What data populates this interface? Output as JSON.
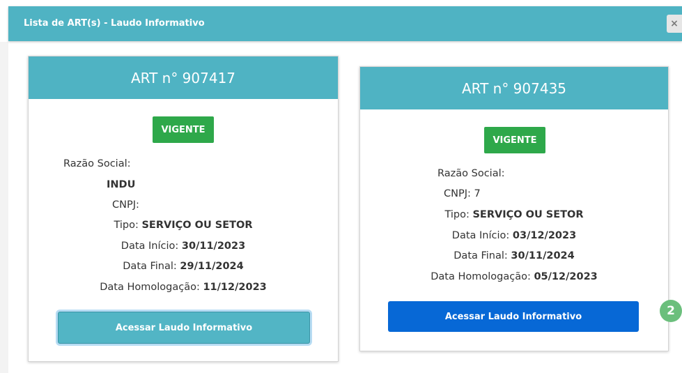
{
  "modal": {
    "title": "Lista de ART(s) - Laudo Informativo",
    "close_label": "×"
  },
  "cards": [
    {
      "header": "ART n° 907417",
      "status": "VIGENTE",
      "razao_social_label": "Razão Social:",
      "razao_social_value": "INDU",
      "cnpj_label": "CNPJ:",
      "cnpj_value": "",
      "tipo_label": "Tipo:",
      "tipo_value": "SERVIÇO OU SETOR",
      "data_inicio_label": "Data Início:",
      "data_inicio_value": "30/11/2023",
      "data_final_label": "Data Final:",
      "data_final_value": "29/11/2024",
      "data_homologacao_label": "Data Homologação:",
      "data_homologacao_value": "11/12/2023",
      "button_label": "Acessar Laudo Informativo"
    },
    {
      "header": "ART n° 907435",
      "status": "VIGENTE",
      "razao_social_label": "Razão Social:",
      "razao_social_value": "",
      "cnpj_label": "CNPJ:",
      "cnpj_value": "7",
      "tipo_label": "Tipo:",
      "tipo_value": "SERVIÇO OU SETOR",
      "data_inicio_label": "Data Início:",
      "data_inicio_value": "03/12/2023",
      "data_final_label": "Data Final:",
      "data_final_value": "30/11/2024",
      "data_homologacao_label": "Data Homologação:",
      "data_homologacao_value": "05/12/2023",
      "button_label": "Acessar Laudo Informativo"
    }
  ],
  "step_badge": "2",
  "colors": {
    "header_teal": "#4fb3c3",
    "status_green": "#2ea84a",
    "primary_blue": "#0768d6",
    "step_green": "#6bbf7c"
  }
}
